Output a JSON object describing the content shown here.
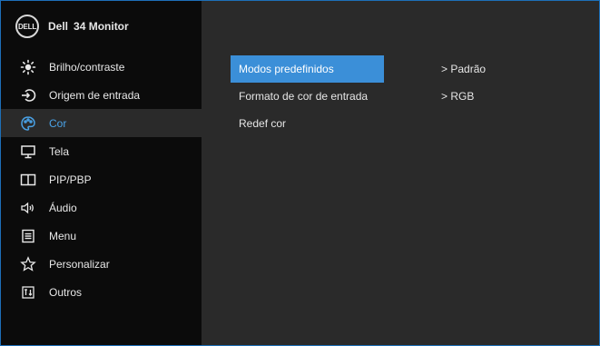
{
  "header": {
    "logo": "DELL",
    "brand": "Dell",
    "model": "34 Monitor"
  },
  "menu": [
    {
      "label": "Brilho/contraste",
      "icon": "brightness-icon"
    },
    {
      "label": "Origem de entrada",
      "icon": "input-source-icon"
    },
    {
      "label": "Cor",
      "icon": "palette-icon"
    },
    {
      "label": "Tela",
      "icon": "display-icon"
    },
    {
      "label": "PIP/PBP",
      "icon": "pip-pbp-icon"
    },
    {
      "label": "Áudio",
      "icon": "speaker-icon"
    },
    {
      "label": "Menu",
      "icon": "menu-icon"
    },
    {
      "label": "Personalizar",
      "icon": "star-icon"
    },
    {
      "label": "Outros",
      "icon": "others-icon"
    }
  ],
  "active_menu": "Cor",
  "submenu": [
    {
      "label": "Modos predefinidos",
      "value": "> Padrão"
    },
    {
      "label": "Formato de cor de entrada",
      "value": "> RGB"
    },
    {
      "label": "Redef cor",
      "value": ""
    }
  ],
  "selected_submenu": "Modos predefinidos",
  "colors": {
    "accent": "#3b8fd8",
    "active_text": "#4aa3e8",
    "sidebar": "#0b0b0b",
    "panel": "#2a2a2a",
    "border": "#1d6fb8"
  }
}
